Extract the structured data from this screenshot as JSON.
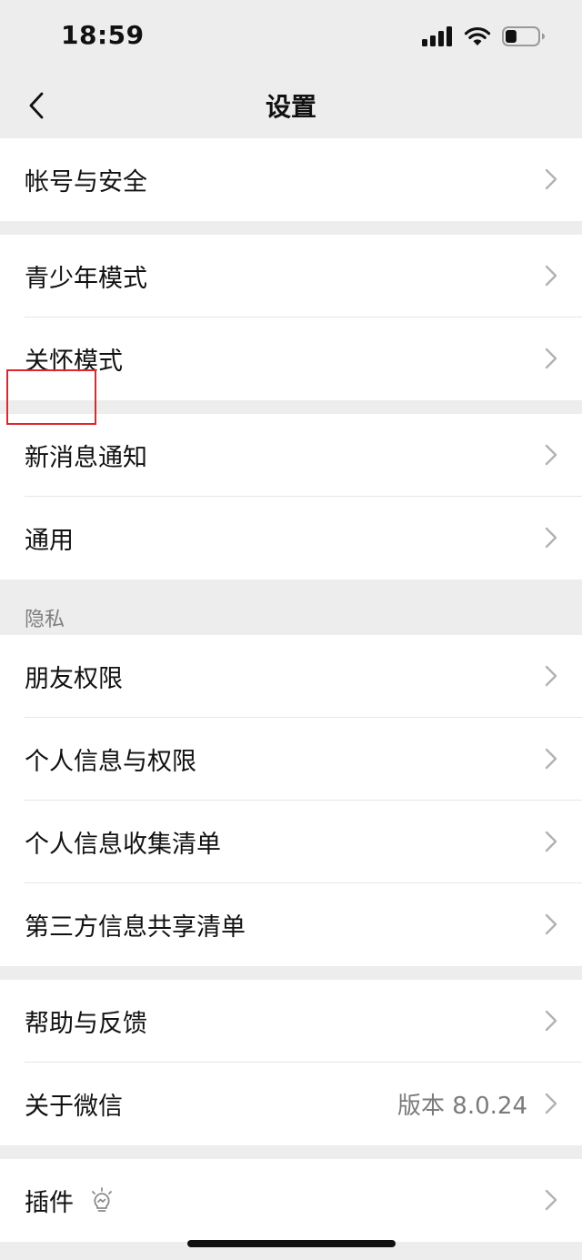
{
  "status_bar": {
    "time": "18:59",
    "battery_percent": 0.35
  },
  "nav": {
    "title": "设置",
    "back_icon": "chevron-left-icon"
  },
  "groups": [
    {
      "items": [
        {
          "label": "帐号与安全"
        }
      ]
    },
    {
      "items": [
        {
          "label": "青少年模式"
        },
        {
          "label": "关怀模式"
        }
      ]
    },
    {
      "items": [
        {
          "label": "新消息通知"
        },
        {
          "label": "通用"
        }
      ]
    },
    {
      "header": "隐私",
      "items": [
        {
          "label": "朋友权限"
        },
        {
          "label": "个人信息与权限"
        },
        {
          "label": "个人信息收集清单"
        },
        {
          "label": "第三方信息共享清单"
        }
      ]
    },
    {
      "items": [
        {
          "label": "帮助与反馈"
        },
        {
          "label": "关于微信",
          "value": "版本 8.0.24"
        }
      ]
    },
    {
      "items": [
        {
          "label": "插件",
          "icon": "lightbulb-icon"
        }
      ]
    }
  ],
  "colors": {
    "background": "#ededed",
    "highlight": "#e0262b",
    "chevron": "#b2b2b2",
    "secondary_text": "#7b7b7b"
  }
}
